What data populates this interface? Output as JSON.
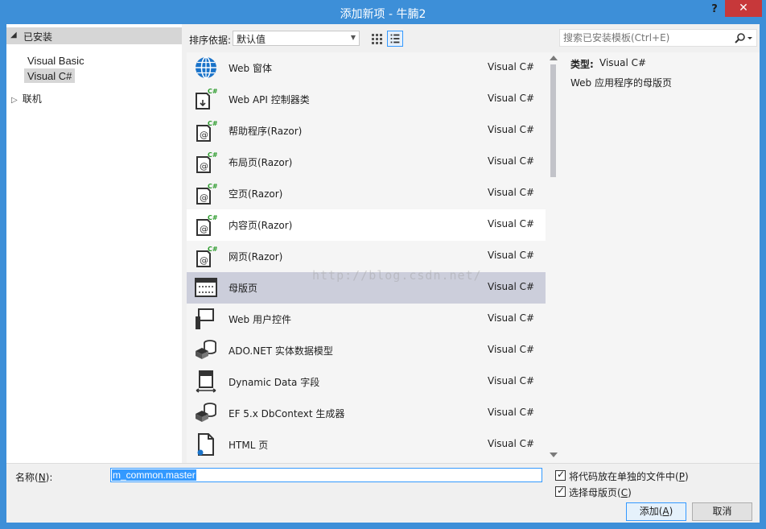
{
  "window": {
    "title": "添加新项 - 牛腩2",
    "help": "?",
    "close": "✕"
  },
  "left": {
    "installed": "已安装",
    "items": [
      "Visual Basic",
      "Visual C#"
    ],
    "online": "联机"
  },
  "toolbar": {
    "sort_label": "排序依据:",
    "sort_value": "默认值"
  },
  "search": {
    "placeholder": "搜索已安装模板(Ctrl+E)"
  },
  "templates": [
    {
      "name": "Web 窗体",
      "lang": "Visual C#",
      "icon": "globe-icon"
    },
    {
      "name": "Web API 控制器类",
      "lang": "Visual C#",
      "icon": "webapi-controller-icon"
    },
    {
      "name": "帮助程序(Razor)",
      "lang": "Visual C#",
      "icon": "razor-page-icon"
    },
    {
      "name": "布局页(Razor)",
      "lang": "Visual C#",
      "icon": "razor-page-icon"
    },
    {
      "name": "空页(Razor)",
      "lang": "Visual C#",
      "icon": "razor-page-icon"
    },
    {
      "name": "内容页(Razor)",
      "lang": "Visual C#",
      "icon": "razor-page-icon"
    },
    {
      "name": "网页(Razor)",
      "lang": "Visual C#",
      "icon": "razor-page-icon"
    },
    {
      "name": "母版页",
      "lang": "Visual C#",
      "icon": "master-page-icon"
    },
    {
      "name": "Web 用户控件",
      "lang": "Visual C#",
      "icon": "user-control-icon"
    },
    {
      "name": "ADO.NET 实体数据模型",
      "lang": "Visual C#",
      "icon": "entity-model-icon"
    },
    {
      "name": "Dynamic Data 字段",
      "lang": "Visual C#",
      "icon": "dynamic-data-icon"
    },
    {
      "name": "EF 5.x DbContext 生成器",
      "lang": "Visual C#",
      "icon": "dbcontext-generator-icon"
    },
    {
      "name": "HTML 页",
      "lang": "Visual C#",
      "icon": "html-page-icon"
    }
  ],
  "watermark": "http://blog.csdn.net/",
  "details": {
    "type_label": "类型:",
    "type_value": "Visual C#",
    "description": "Web 应用程序的母版页"
  },
  "bottom": {
    "name_label_pre": "名称(",
    "name_label_key": "N",
    "name_label_post": "):",
    "name_value": "m_common.master",
    "chk1_pre": "将代码放在单独的文件中(",
    "chk1_key": "P",
    "chk1_post": ")",
    "chk2_pre": "选择母版页(",
    "chk2_key": "C",
    "chk2_post": ")",
    "add_pre": "添加(",
    "add_key": "A",
    "add_post": ")",
    "cancel": "取消"
  }
}
